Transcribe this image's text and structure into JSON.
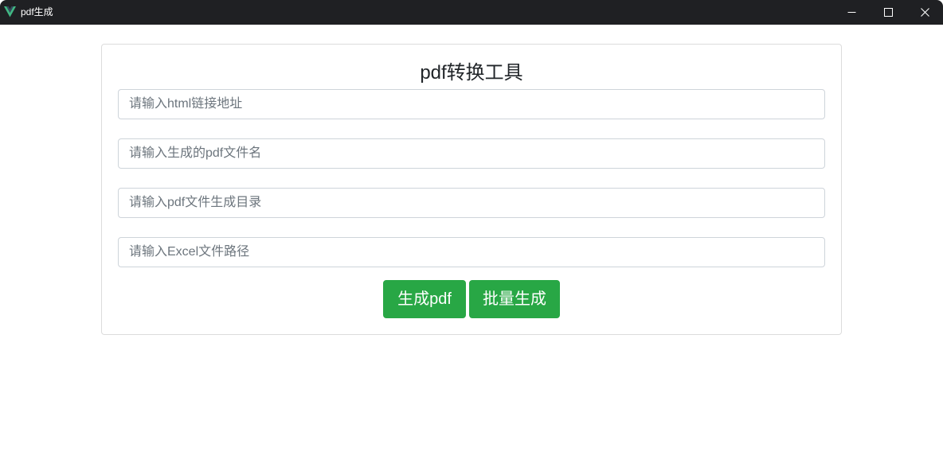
{
  "window": {
    "title": "pdf生成",
    "titlebar_color": "#1f2023",
    "app_icon": "vue-logo-icon",
    "controls": [
      "minimize-icon",
      "maximize-icon",
      "close-icon"
    ]
  },
  "form": {
    "heading": "pdf转换工具",
    "fields": [
      {
        "placeholder": "请输入html链接地址",
        "value": ""
      },
      {
        "placeholder": "请输入生成的pdf文件名",
        "value": ""
      },
      {
        "placeholder": "请输入pdf文件生成目录",
        "value": ""
      },
      {
        "placeholder": "请输入Excel文件路径",
        "value": ""
      }
    ],
    "buttons": {
      "generate_label": "生成pdf",
      "batch_label": "批量生成",
      "color": "#28a745"
    }
  }
}
